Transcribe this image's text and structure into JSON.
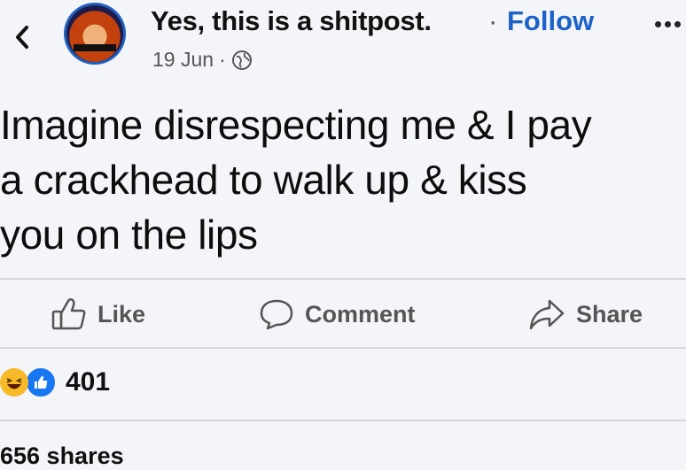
{
  "header": {
    "page_name": "Yes, this is a shitpost.",
    "separator": "·",
    "follow_label": "Follow",
    "date": "19 Jun",
    "meta_separator": "·",
    "audience_icon": "globe-icon",
    "back_icon": "chevron-left-icon",
    "more_icon": "more-options-icon"
  },
  "post": {
    "lines": [
      "Imagine disrespecting me & I pay",
      "a crackhead to walk up & kiss",
      "you on the lips"
    ]
  },
  "actions": {
    "like_label": "Like",
    "comment_label": "Comment",
    "share_label": "Share"
  },
  "stats": {
    "reaction_icons": [
      "haha-reaction-icon",
      "like-reaction-icon"
    ],
    "reaction_count": "401",
    "shares": "656 shares"
  },
  "colors": {
    "background": "#f4f5f9",
    "accent": "#1c62c9",
    "like_blue": "#1877f2",
    "haha_yellow": "#f7b928"
  }
}
